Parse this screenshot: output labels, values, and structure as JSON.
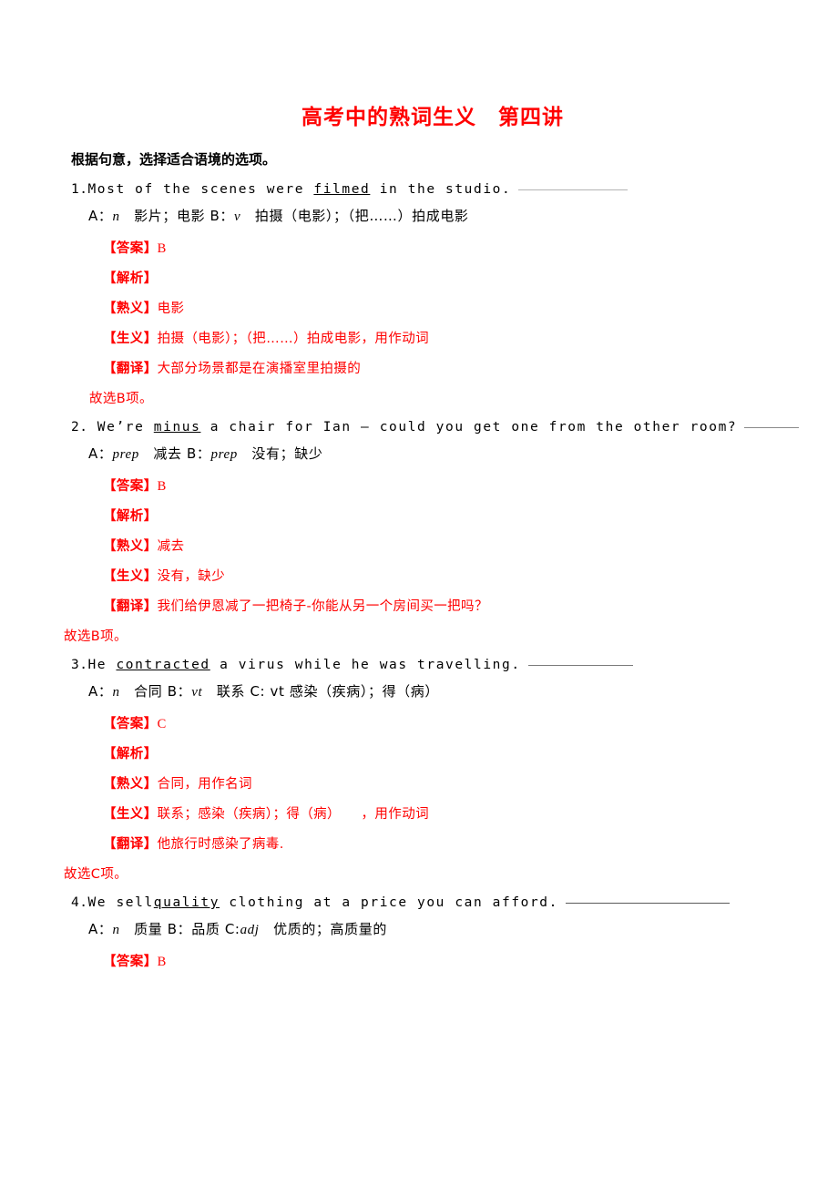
{
  "document": {
    "title": "高考中的熟词生义　第四讲",
    "instruction": "根据句意，选择适合语境的选项。",
    "labels": {
      "answer": "【答案】",
      "analysis": "【解析】",
      "common_meaning": "【熟义】",
      "new_meaning": "【生义】",
      "translation": "【翻译】"
    },
    "colors": {
      "title_red": "#ff0000",
      "body_black": "#000000",
      "blank_line_gray": "#6e6e6e",
      "page_background": "#ffffff"
    },
    "questions": [
      {
        "number": "1.",
        "stem_before": "Most of the scenes were ",
        "keyword": "filmed",
        "stem_after": " in the studio.",
        "options": "A：n 　影片；电影 B：v 　拍摄（电影）；（把……）拍成电影",
        "option_parts": {
          "a_label": "A：",
          "a_pos": "n",
          "a_text": "　影片；电影 ",
          "b_label": "B：",
          "b_pos": "v",
          "b_text": "　拍摄（电影）；（把……）拍成电影"
        },
        "answer": "B",
        "analysis": "",
        "common_meaning": "电影",
        "new_meaning": "拍摄（电影）；（把……）拍成电影，用作动词",
        "translation": "大部分场景都是在演播室里拍摄的",
        "conclusion": "故选B项。"
      },
      {
        "number": "2.",
        "stem_before": " We’re ",
        "keyword": "minus",
        "stem_after": " a chair for Ian — could you get one from the other room?",
        "options": "A：prep 　减去 B：prep 　没有；缺少",
        "option_parts": {
          "a_label": "A：",
          "a_pos": "prep",
          "a_text": "　减去 ",
          "b_label": "B：",
          "b_pos": "prep",
          "b_text": "　没有；缺少",
          "c_label": "",
          "c_pos": "",
          "c_text": ""
        },
        "answer": "B",
        "analysis": "",
        "common_meaning": "减去",
        "new_meaning": "没有，缺少",
        "translation": "我们给伊恩减了一把椅子-你能从另一个房间买一把吗？",
        "conclusion": "故选B项。"
      },
      {
        "number": "3.",
        "stem_before": "He ",
        "keyword": "contracted",
        "stem_after": " a virus  while he was travelling.",
        "options": "A：n 　合同 B：vt 　联系 C: vt 感染（疾病）；得（病）",
        "option_parts": {
          "a_label": "A：",
          "a_pos": "n",
          "a_text": "　合同 ",
          "b_label": "B：",
          "b_pos": "vt",
          "b_text": "　联系 ",
          "c_label": "C:",
          "c_pos": " vt",
          "c_text": " 感染（疾病）；得（病）"
        },
        "answer": "C",
        "analysis": "",
        "common_meaning": "合同，用作名词",
        "new_meaning": "联系；感染（疾病）；得（病）　　，用作动词",
        "translation": "他旅行时感染了病毒.",
        "conclusion": "故选C项。"
      },
      {
        "number": "4.",
        "stem_before": "We sell",
        "keyword": "quality",
        "stem_after": " clothing at a price you can afford.",
        "options": "A：n 　质量 B：品质 C:adj 　优质的；高质量的",
        "option_parts": {
          "a_label": "A：",
          "a_pos": "n",
          "a_text": "　质量 ",
          "b_label": "B：",
          "b_pos": "",
          "b_text": "品质 ",
          "c_label": "C:",
          "c_pos": "adj",
          "c_text": "　优质的；高质量的"
        },
        "answer": "B",
        "analysis": null,
        "common_meaning": null,
        "new_meaning": null,
        "translation": null,
        "conclusion": null
      }
    ]
  }
}
